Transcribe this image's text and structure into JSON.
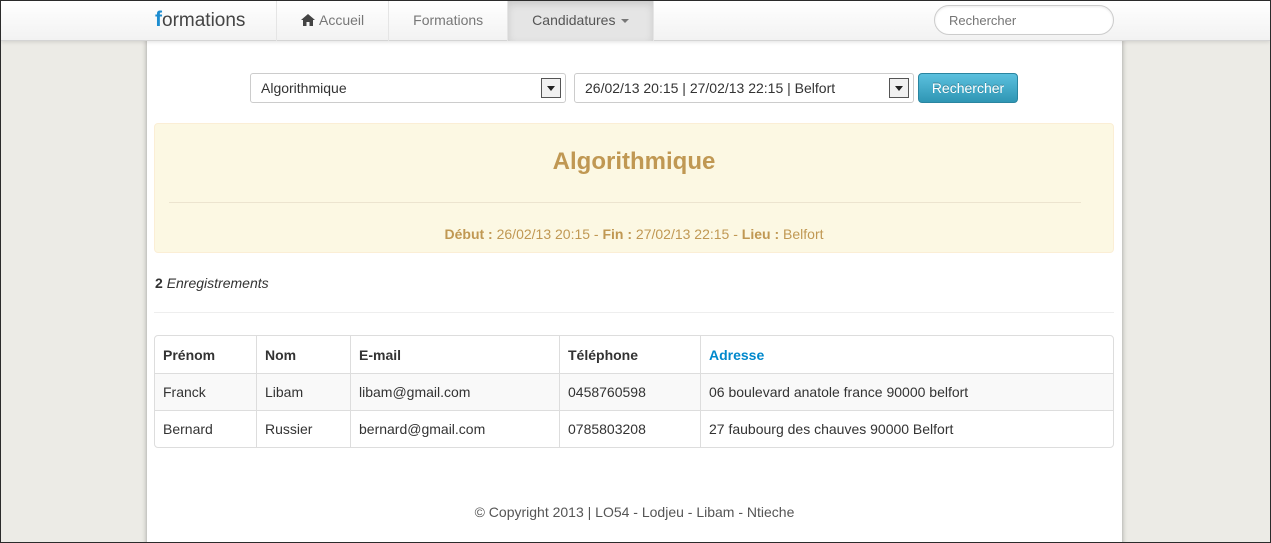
{
  "brand": {
    "icon_letter": "f",
    "text": "ormations"
  },
  "nav": {
    "items": [
      {
        "label": "Accueil",
        "icon": "home-icon"
      },
      {
        "label": "Formations"
      },
      {
        "label": "Candidatures",
        "icon": "caret-down-icon",
        "active": true
      }
    ],
    "search_placeholder": "Rechercher"
  },
  "filters": {
    "formation_selected": "Algorithmique",
    "session_selected": "26/02/13 20:15 | 27/02/13 22:15 | Belfort",
    "search_button": "Rechercher"
  },
  "session": {
    "title": "Algorithmique",
    "start_label": "Début :",
    "start_value": "26/02/13 20:15",
    "end_label": "Fin :",
    "end_value": "27/02/13 22:15",
    "place_label": "Lieu :",
    "place_value": "Belfort",
    "separator": " - "
  },
  "records": {
    "count": "2",
    "label": "Enregistrements"
  },
  "table": {
    "headers": [
      "Prénom",
      "Nom",
      "E-mail",
      "Téléphone",
      "Adresse"
    ],
    "sorted_column": "Adresse",
    "rows": [
      [
        "Franck",
        "Libam",
        "libam@gmail.com",
        "0458760598",
        "06 boulevard anatole france 90000 belfort"
      ],
      [
        "Bernard",
        "Russier",
        "bernard@gmail.com",
        "0785803208",
        "27 faubourg des chauves 90000 Belfort"
      ]
    ]
  },
  "footer": {
    "text": "© Copyright 2013 | LO54 - Lodjeu - Libam - Ntieche"
  },
  "colors": {
    "brand_accent": "#1d8dd0",
    "info_text": "#c09853",
    "info_bg": "#fcf8e3",
    "button": "#49afcd",
    "sorted_header": "#0088cc"
  }
}
